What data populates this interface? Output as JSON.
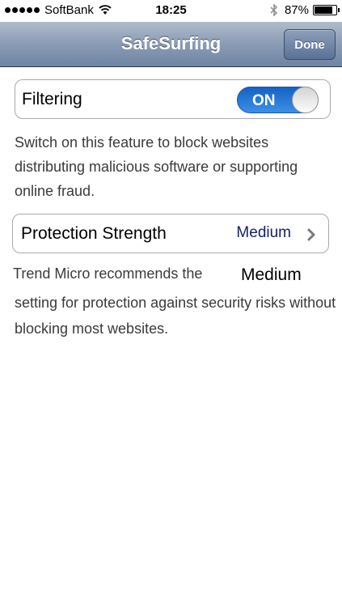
{
  "status_bar": {
    "carrier": "SoftBank",
    "time": "18:25",
    "battery_percent": "87%",
    "battery_level": 0.87,
    "signal_bars": 5
  },
  "nav": {
    "title": "SafeSurfing",
    "done_label": "Done"
  },
  "filtering": {
    "label": "Filtering",
    "toggle_state": "ON",
    "description": "Switch on this feature to block websites distributing malicious software or supporting online fraud."
  },
  "protection": {
    "label": "Protection Strength",
    "value": "Medium",
    "description_prefix": "Trend Micro recommends the",
    "description_highlight": "Medium",
    "description_rest": "setting for protection against security risks without blocking most websites."
  },
  "colors": {
    "toggle_on": "#1f74d6",
    "value_text": "#14216a",
    "nav_bar": "#8a9bb5"
  }
}
